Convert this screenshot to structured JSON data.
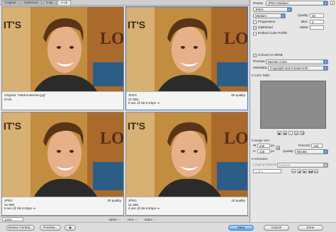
{
  "tabs": [
    {
      "label": "Original"
    },
    {
      "label": "Optimized"
    },
    {
      "label": "2-Up"
    },
    {
      "label": "4-Up",
      "selected": true
    }
  ],
  "panes": [
    {
      "line1": "Original: \"MarkAndersen.jpg\"",
      "line2": "672K",
      "line3": "",
      "right": ""
    },
    {
      "line1": "JPEG",
      "line2": "21.96K",
      "line3": "5 sec @ 56.6 Kbps  ⇥",
      "right": "60 quality"
    },
    {
      "line1": "JPEG",
      "line2": "21.96K",
      "line3": "5 sec @ 56.6 Kbps  ⇥",
      "right": "30 quality"
    },
    {
      "line1": "JPEG",
      "line2": "21.96K",
      "line3": "4 sec @ 56.6 Kbps  ⇥",
      "right": "15 quality"
    }
  ],
  "status": {
    "alpha_label": "Alpha: --",
    "hex_label": "Hex: --",
    "index_label": "Index: --"
  },
  "bottom": {
    "zoom": "100%",
    "device_central": "Device Central...",
    "preview": "Preview...",
    "save": "Save",
    "cancel": "Cancel",
    "done": "Done"
  },
  "panel": {
    "preset_label": "Preset:",
    "preset_value": "JPEG Medium",
    "format_value": "JPEG",
    "quality_level": "Medium",
    "quality_label": "Quality:",
    "quality_value": "30",
    "progressive": "Progressive",
    "blur_label": "Blur:",
    "blur_value": "0",
    "optimized": "Optimized",
    "matte_label": "Matte:",
    "embed": "Embed Color Profile",
    "convert": "Convert to sRGB",
    "preview_label": "Preview:",
    "preview_value": "Monitor Color",
    "metadata_label": "Metadata:",
    "metadata_value": "Copyright and Contact Info",
    "color_table": "Color Table",
    "image_size": "Image Size",
    "w_label": "W:",
    "w_value": "535",
    "h_label": "H:",
    "h_value": "428",
    "px": "px",
    "percent_label": "Percent:",
    "percent_value": "100",
    "quality2_label": "Quality:",
    "quality2_value": "Bicubic",
    "animation": "Animation",
    "looping_label": "Looping Options:",
    "looping_value": "Forever",
    "frame_value": "1 of 1"
  }
}
